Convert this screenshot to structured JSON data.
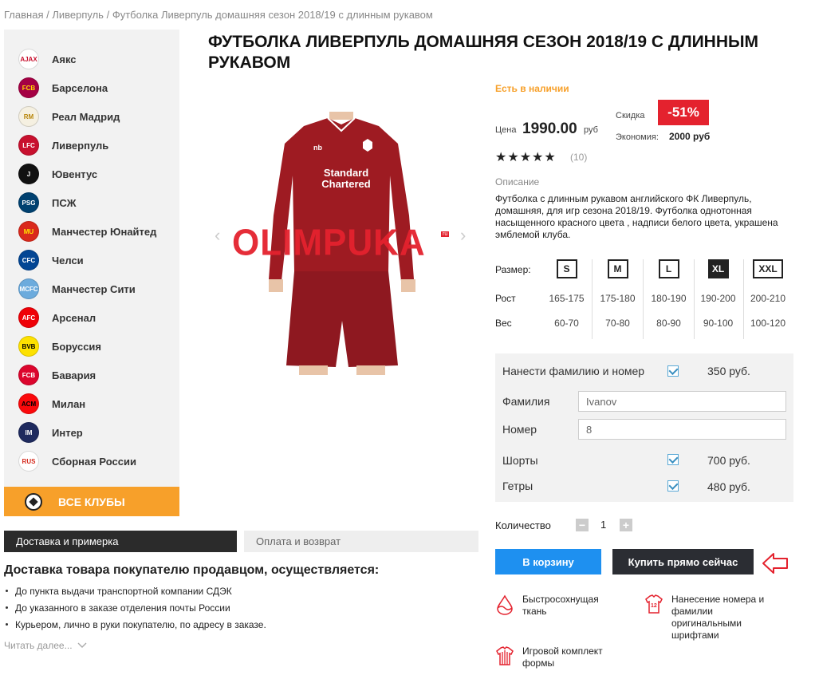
{
  "breadcrumbs": [
    "Главная",
    "Ливерпуль",
    "Футболка Ливерпуль домашняя сезон 2018/19 с длинным рукавом"
  ],
  "breadcrumb_sep": " / ",
  "clubs": [
    {
      "name": "Аякс",
      "abbr": "AJAX",
      "color": "#ffffff",
      "text": "#c8102e"
    },
    {
      "name": "Барселона",
      "abbr": "FCB",
      "color": "#a50044",
      "text": "#ffd700"
    },
    {
      "name": "Реал Мадрид",
      "abbr": "RM",
      "color": "#f5f0e1",
      "text": "#b8860b"
    },
    {
      "name": "Ливерпуль",
      "abbr": "LFC",
      "color": "#c8102e",
      "text": "#ffffff"
    },
    {
      "name": "Ювентус",
      "abbr": "J",
      "color": "#111111",
      "text": "#ffffff"
    },
    {
      "name": "ПСЖ",
      "abbr": "PSG",
      "color": "#004170",
      "text": "#ffffff"
    },
    {
      "name": "Манчестер Юнайтед",
      "abbr": "MU",
      "color": "#da291c",
      "text": "#ffe500"
    },
    {
      "name": "Челси",
      "abbr": "CFC",
      "color": "#034694",
      "text": "#ffffff"
    },
    {
      "name": "Манчестер Сити",
      "abbr": "MCFC",
      "color": "#6cabdd",
      "text": "#ffffff"
    },
    {
      "name": "Арсенал",
      "abbr": "AFC",
      "color": "#ef0107",
      "text": "#ffffff"
    },
    {
      "name": "Боруссия",
      "abbr": "BVB",
      "color": "#fde100",
      "text": "#000000"
    },
    {
      "name": "Бавария",
      "abbr": "FCB",
      "color": "#dc052d",
      "text": "#ffffff"
    },
    {
      "name": "Милан",
      "abbr": "ACM",
      "color": "#fb090b",
      "text": "#000000"
    },
    {
      "name": "Интер",
      "abbr": "IM",
      "color": "#1e2a5e",
      "text": "#ffffff"
    },
    {
      "name": "Сборная России",
      "abbr": "RUS",
      "color": "#ffffff",
      "text": "#d52b1e"
    }
  ],
  "all_clubs_label": "ВСЕ КЛУБЫ",
  "tabs": {
    "delivery": "Доставка и примерка",
    "payment": "Оплата и возврат"
  },
  "delivery": {
    "title": "Доставка товара покупателю продавцом, осуществляется:",
    "items": [
      "До пункта выдачи транспортной компании СДЭК",
      "До указанного в заказе отделения почты России",
      "Курьером, лично в руки покупателю, по адресу в заказе."
    ],
    "more": "Читать далее..."
  },
  "product": {
    "title": "ФУТБОЛКА ЛИВЕРПУЛЬ ДОМАШНЯЯ СЕЗОН 2018/19 С ДЛИННЫМ РУКАВОМ",
    "image_brand": "OLIMPUKA",
    "image_brand_sup": "ru",
    "shirt_sponsor": "Standard Chartered",
    "in_stock": "Есть в наличии",
    "price_label": "Цена",
    "price": "1990.00",
    "currency": "руб",
    "discount_label": "Скидка",
    "discount": "-51%",
    "economy_label": "Экономия:",
    "economy": "2000 руб",
    "stars": "★★★★★",
    "rating": 5,
    "reviews": "(10)",
    "desc_label": "Описание",
    "description": "Футболка с длинным рукавом английского ФК Ливерпуль, домашняя, для игр сезона 2018/19. Футболка однотонная насыщенного красного цвета , надписи белого цвета, украшена эмблемой клуба."
  },
  "sizes": {
    "label": "Размер:",
    "height_label": "Рост",
    "weight_label": "Вес",
    "list": [
      {
        "size": "S",
        "height": "165-175",
        "weight": "60-70",
        "selected": false
      },
      {
        "size": "M",
        "height": "175-180",
        "weight": "70-80",
        "selected": false
      },
      {
        "size": "L",
        "height": "180-190",
        "weight": "80-90",
        "selected": false
      },
      {
        "size": "XL",
        "height": "190-200",
        "weight": "90-100",
        "selected": true
      },
      {
        "size": "XXL",
        "height": "200-210",
        "weight": "100-120",
        "selected": false
      }
    ]
  },
  "custom": {
    "print_label": "Нанести фамилию и номер",
    "print_price": "350 руб.",
    "surname_label": "Фамилия",
    "surname_value": "Ivanov",
    "number_label": "Номер",
    "number_value": "8",
    "shorts_label": "Шорты",
    "shorts_price": "700 руб.",
    "socks_label": "Гетры",
    "socks_price": "480 руб."
  },
  "quantity": {
    "label": "Количество",
    "value": "1",
    "minus": "−",
    "plus": "+"
  },
  "buttons": {
    "cart": "В корзину",
    "buy_now": "Купить прямо сейчас"
  },
  "features": [
    {
      "icon": "drop-icon",
      "text": "Быстросохнущая ткань"
    },
    {
      "icon": "jersey-number-icon",
      "text": "Нанесение номера и фамилии оригинальными шрифтами"
    },
    {
      "icon": "jersey-stripes-icon",
      "text": "Игровой комплект формы"
    }
  ],
  "colors": {
    "accent_orange": "#f7a02a",
    "discount_red": "#e4222e",
    "cart_blue": "#1e90f0",
    "dark": "#2b2d33",
    "kit_red": "#9e1b22"
  }
}
